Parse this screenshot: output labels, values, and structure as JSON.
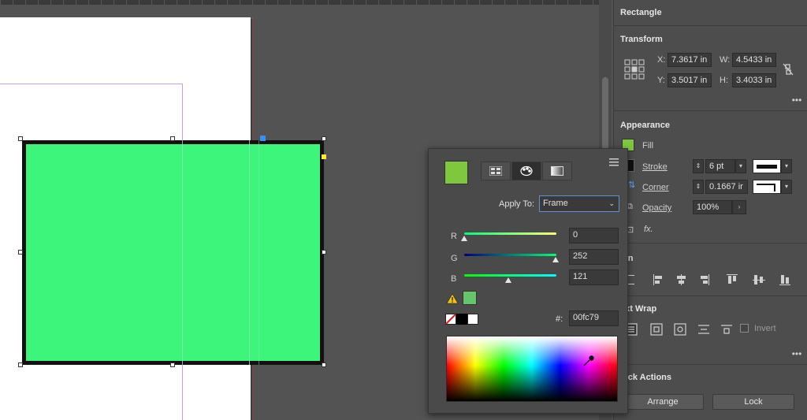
{
  "colors": {
    "frame_fill": "#3cf57a",
    "fill_swatch": "#7fc73f",
    "preview_swatch": "#66c46a",
    "panel_bg": "#4d4d4d"
  },
  "properties": {
    "object_type": "Rectangle",
    "transform": {
      "title": "Transform",
      "x_label": "X:",
      "x_value": "7.3617 in",
      "y_label": "Y:",
      "y_value": "3.5017 in",
      "w_label": "W:",
      "w_value": "4.5433 in",
      "h_label": "H:",
      "h_value": "3.4033 in"
    },
    "appearance": {
      "title": "Appearance",
      "fill_label": "Fill",
      "stroke_label": "Stroke",
      "stroke_value": "6 pt",
      "corner_label": "Corner",
      "corner_value": "0.1667 ir",
      "opacity_label": "Opacity",
      "opacity_value": "100%",
      "fx_label": "fx."
    },
    "align_title": "ign",
    "text_wrap": {
      "title": "ext Wrap",
      "invert_label": "Invert"
    },
    "quick_actions": {
      "title": "uick Actions",
      "arrange_label": "Arrange",
      "lock_label": "Lock"
    },
    "more_glyph": "•••"
  },
  "color_popup": {
    "apply_to_label": "Apply To:",
    "apply_to_value": "Frame",
    "r_label": "R",
    "r_value": "0",
    "g_label": "G",
    "g_value": "252",
    "b_label": "B",
    "b_value": "121",
    "hex_label": "#:",
    "hex_value": "00fc79",
    "r_level": 0.0,
    "g_level": 0.988,
    "b_level": 0.475
  }
}
